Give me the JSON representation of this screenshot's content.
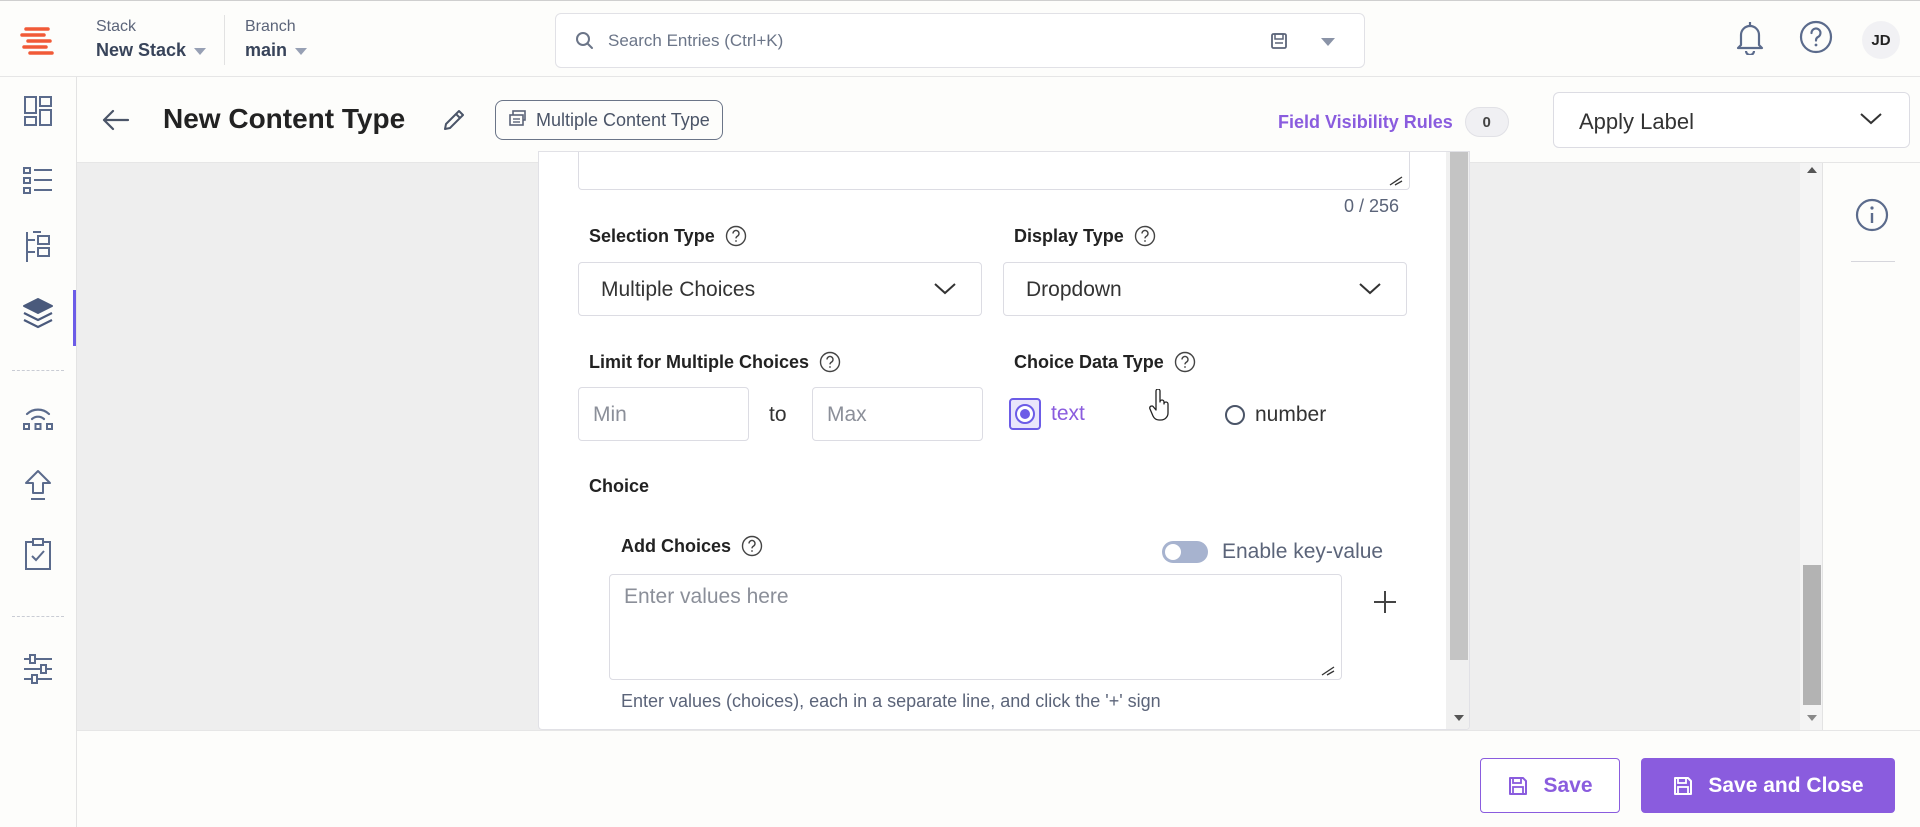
{
  "topbar": {
    "stack_label": "Stack",
    "stack_value": "New Stack",
    "branch_label": "Branch",
    "branch_value": "main",
    "search_placeholder": "Search Entries (Ctrl+K)",
    "avatar_initials": "JD"
  },
  "header": {
    "title": "New Content Type",
    "type_badge": "Multiple Content Type",
    "field_visibility_label": "Field Visibility Rules",
    "field_visibility_count": "0",
    "apply_label": "Apply Label"
  },
  "form": {
    "char_count": "0 / 256",
    "selection_type_label": "Selection Type",
    "selection_type_value": "Multiple Choices",
    "display_type_label": "Display Type",
    "display_type_value": "Dropdown",
    "limit_label": "Limit for Multiple Choices",
    "min_placeholder": "Min",
    "to_label": "to",
    "max_placeholder": "Max",
    "choice_data_type_label": "Choice Data Type",
    "radio_text": "text",
    "radio_number": "number",
    "choice_heading": "Choice",
    "add_choices_label": "Add Choices",
    "enable_key_value": "Enable key-value",
    "choices_placeholder": "Enter values here",
    "choices_hint": "Enter values (choices), each in a separate line, and click the '+' sign"
  },
  "footer": {
    "save_label": "Save",
    "save_close_label": "Save and Close"
  },
  "colors": {
    "accent": "#8a5cde",
    "accent_dark": "#6c5ce7",
    "logo": "#f15a37",
    "nav_icon": "#5b6b8c"
  }
}
